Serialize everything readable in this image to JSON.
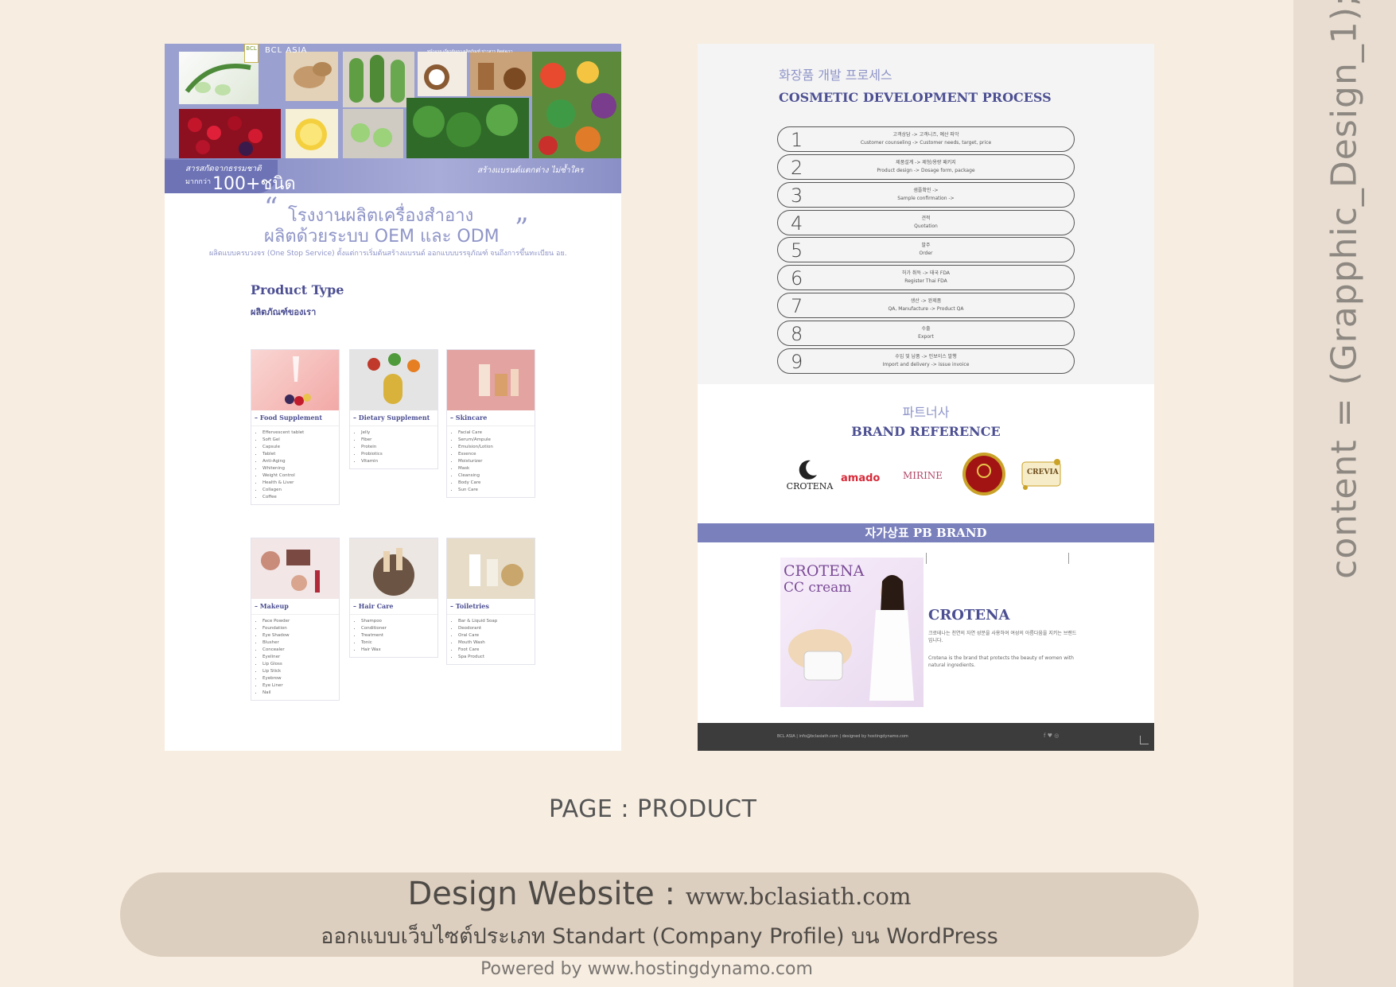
{
  "side_label": "content = (Grapphic_Design_1);",
  "page_label": "PAGE : PRODUCT",
  "design_website_label": "Design Website : ",
  "design_website_url": "www.bclasiath.com",
  "design_subtitle": "ออกแบบเว็บไซต์ประเภท Standart (Company Profile) บน WordPress",
  "powered_by": "Powered by www.hostingdynamo.com",
  "colors": {
    "background": "#f7ede1",
    "accent": "#8f95c8",
    "accent_dark": "#4c4f92",
    "pill": "#ddcfbf"
  },
  "left_page": {
    "logo_text": "BCL",
    "brand": "BCL ASIA",
    "nav": "หน้าแรก   เกี่ยวกับเรา   ผลิตภัณฑ์   ข่าวสาร   ติดต่อเรา",
    "band_left_line1": "สารสกัดจากธรรมชาติ",
    "band_left_line2": "มากกว่า",
    "band_left_big": "100+ชนิด",
    "band_right": "สร้างแบรนด์แตกต่าง ไม่ซ้ำใคร",
    "headline_1": "โรงงานผลิตเครื่องสำอาง",
    "headline_2": "ผลิตด้วยระบบ OEM และ ODM",
    "subline": "ผลิตแบบครบวงจร (One Stop Service) ตั้งแต่การเริ่มต้นสร้างแบรนด์ ออกแบบบรรจุภัณฑ์ จนถึงการขึ้นทะเบียน อย.",
    "product_type_title": "Product Type",
    "product_type_sub": "ผลิตภัณฑ์ของเรา",
    "cards": [
      {
        "title": "Food Supplement",
        "items": [
          "Effervescent tablet",
          "Soft Gel",
          "Capsule",
          "Tablet",
          "Anti-Aging",
          "Whitening",
          "Weight Control",
          "Health & Liver",
          "Collagen",
          "Coffee"
        ]
      },
      {
        "title": "Dietary Supplement",
        "items": [
          "Jelly",
          "Fiber",
          "Protein",
          "Probiotics",
          "Vitamin"
        ]
      },
      {
        "title": "Skincare",
        "items": [
          "Facial Care",
          "Serum/Ampule",
          "Emulsion/Lotion",
          "Essence",
          "Moisturizer",
          "Mask",
          "Cleansing",
          "Body Care",
          "Sun Care"
        ]
      },
      {
        "title": "Makeup",
        "items": [
          "Face Powder",
          "Foundation",
          "Eye Shadow",
          "Blusher",
          "Concealer",
          "Eyeliner",
          "Lip Gloss",
          "Lip Stick",
          "Eyebrow",
          "Eye Liner",
          "Nail"
        ]
      },
      {
        "title": "Hair Care",
        "items": [
          "Shampoo",
          "Conditioner",
          "Treatment",
          "Tonic",
          "Hair Wax"
        ]
      },
      {
        "title": "Toiletries",
        "items": [
          "Bar & Liquid Soap",
          "Deodorant",
          "Oral Care",
          "Mouth Wash",
          "Foot Care",
          "Spa Product"
        ]
      }
    ]
  },
  "right_page": {
    "process_title_kr": "화장품 개발 프로세스",
    "process_title_en": "COSMETIC DEVELOPMENT PROCESS",
    "steps": [
      {
        "num": "1",
        "kr": "고객상담 -> 고객니즈, 예산 파악",
        "en": "Customer counseling -> Customer needs, target, price"
      },
      {
        "num": "2",
        "kr": "제품설계 -> 제형/용량 패키지",
        "en": "Product design -> Dosage form, package"
      },
      {
        "num": "3",
        "kr": "샘플확인 ->",
        "en": "Sample confirmation ->"
      },
      {
        "num": "4",
        "kr": "견적",
        "en": "Quotation"
      },
      {
        "num": "5",
        "kr": "발주",
        "en": "Order"
      },
      {
        "num": "6",
        "kr": "허가 취득 -> 태국 FDA",
        "en": "Register Thai FDA"
      },
      {
        "num": "7",
        "kr": "생산 -> 완제품",
        "en": "QA, Manufacture -> Product QA"
      },
      {
        "num": "8",
        "kr": "수출",
        "en": "Export"
      },
      {
        "num": "9",
        "kr": "수입 및 납품 -> 인보이스 발행",
        "en": "Import and delivery -> issue invoice"
      }
    ],
    "partner_kr": "파트너사",
    "partner_en": "BRAND REFERENCE",
    "brands": [
      "CROTENA",
      "amado",
      "MIRINE",
      "",
      "CREVIA"
    ],
    "pb_brand": "자가상표 PB BRAND",
    "ad_line1": "CROTENA",
    "ad_line2": "CC cream",
    "crotena_title": "CROTENA",
    "crotena_p1": "크로테나는 천연의 자연 성분을 사용하여 여성의 아름다움을 지키는 브랜드입니다.",
    "crotena_p2": "Crotena is the brand that protects the beauty of women with natural ingredients.",
    "footer_text": "BCL ASIA | info@bclasiath.com | designed by hostingdynamo.com",
    "footer_icons": "f  ♥  ◎"
  }
}
